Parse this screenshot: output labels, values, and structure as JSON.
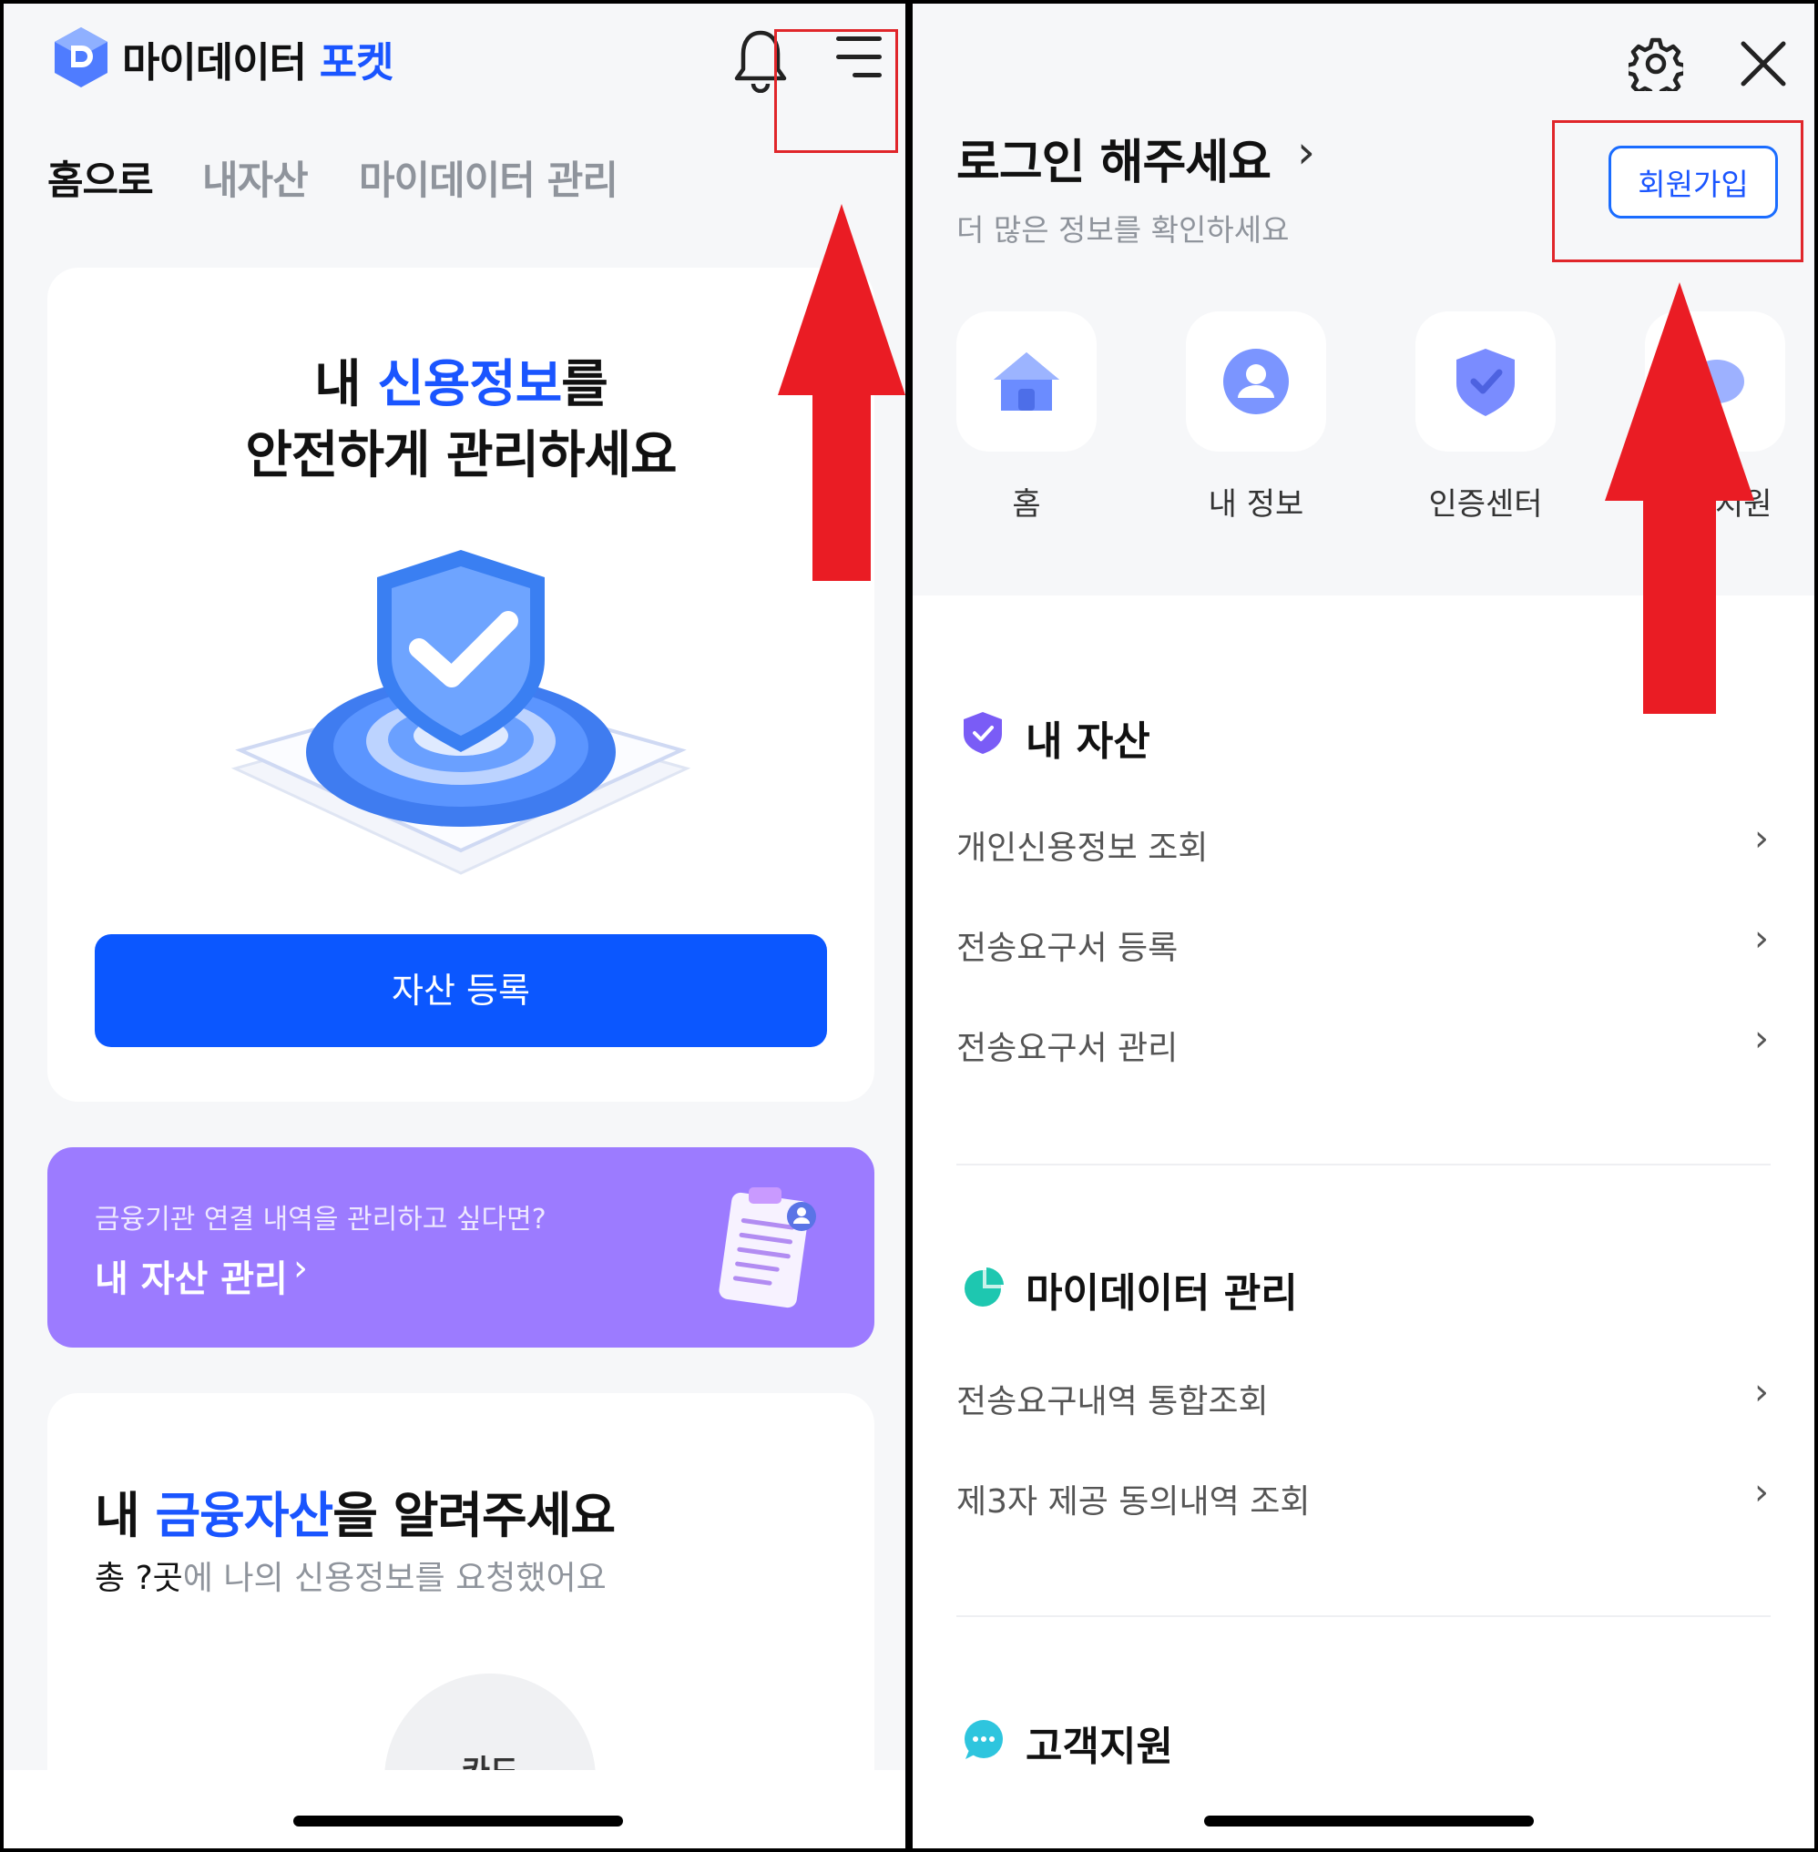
{
  "left": {
    "brand": {
      "name": "마이데이터",
      "accent": "포켓"
    },
    "icons": {
      "logo": "cube-logo",
      "bell": "bell-icon",
      "menu": "hamburger-menu-icon"
    },
    "tabs": [
      {
        "label": "홈으로",
        "active": true
      },
      {
        "label": "내자산",
        "active": false
      },
      {
        "label": "마이데이터 관리",
        "active": false
      }
    ],
    "hero": {
      "line1_pre": "내 ",
      "line1_accent": "신용정보",
      "line1_post": "를",
      "line2": "안전하게 관리하세요",
      "button": "자산 등록"
    },
    "promo": {
      "subtitle": "금융기관 연결 내역을 관리하고 싶다면?",
      "title": "내 자산 관리",
      "chevron": "›"
    },
    "assets_card": {
      "title_pre": "내 ",
      "title_accent": "금융자산",
      "title_post": "을 알려주세요",
      "sub_dark": "총 ?곳",
      "sub_rest": "에 나의 신용정보를 요청했어요",
      "circle_label": "카드"
    }
  },
  "right": {
    "icons": {
      "settings": "gear-icon",
      "close": "close-icon"
    },
    "login": {
      "title": "로그인 해주세요",
      "chevron": "›",
      "subtitle": "더 많은 정보를 확인하세요",
      "signup": "회원가입"
    },
    "quick_menu": [
      {
        "label": "홈",
        "icon": "home-icon"
      },
      {
        "label": "내 정보",
        "icon": "user-icon"
      },
      {
        "label": "인증센터",
        "icon": "shield-check-icon"
      },
      {
        "label": "고객지원",
        "icon": "chat-icon"
      }
    ],
    "sections": [
      {
        "title": "내 자산",
        "icon": "shield-icon",
        "items": [
          "개인신용정보 조회",
          "전송요구서 등록",
          "전송요구서 관리"
        ]
      },
      {
        "title": "마이데이터 관리",
        "icon": "pie-chart-icon",
        "items": [
          "전송요구내역 통합조회",
          "제3자 제공 동의내역 조회"
        ]
      },
      {
        "title": "고객지원",
        "icon": "chat-bubble-icon",
        "items": []
      }
    ],
    "chevron": "›"
  },
  "colors": {
    "accent": "#1a55ff",
    "cta": "#0b57ff",
    "promo": "#9c7bff",
    "annotation": "#e0262b"
  }
}
